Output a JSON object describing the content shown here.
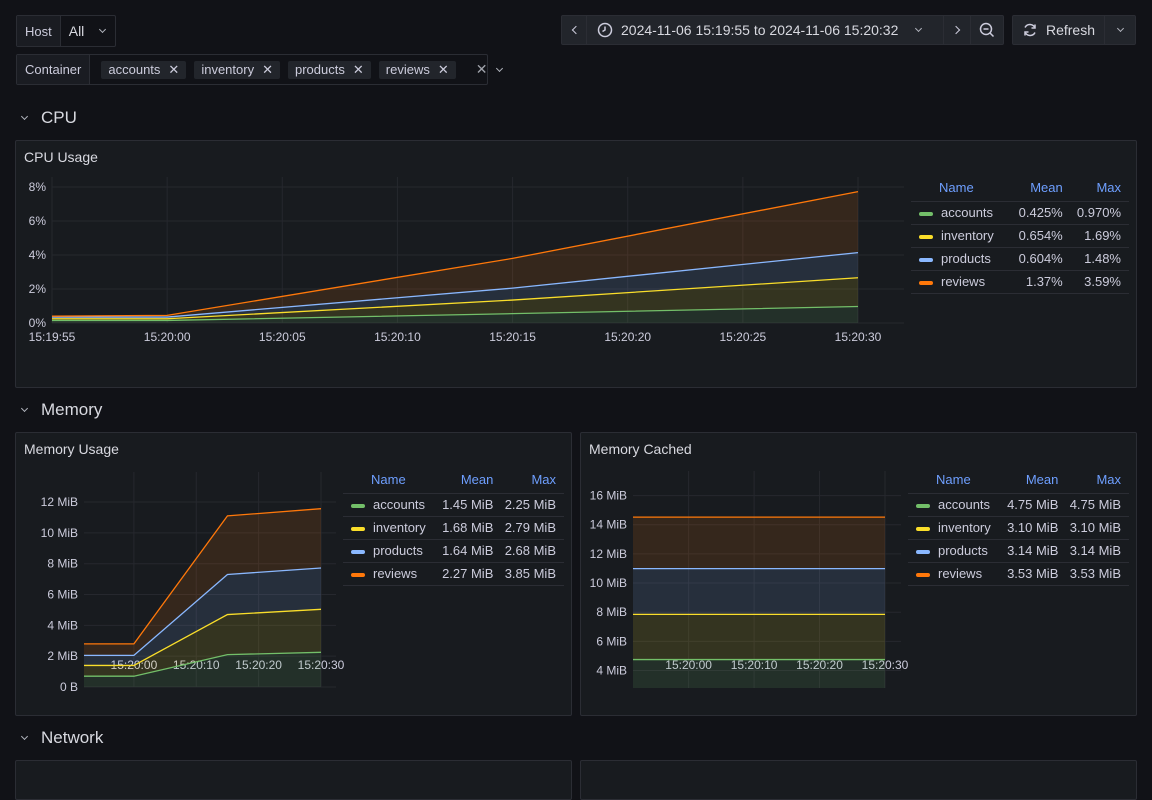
{
  "variables": {
    "host": {
      "label": "Host",
      "value": "All"
    },
    "container": {
      "label": "Container",
      "values": [
        "accounts",
        "inventory",
        "products",
        "reviews"
      ]
    }
  },
  "toolbar": {
    "time_range": "2024-11-06 15:19:55 to 2024-11-06 15:20:32",
    "refresh_label": "Refresh"
  },
  "sections": {
    "cpu": "CPU",
    "memory": "Memory",
    "network": "Network"
  },
  "series_colors": {
    "accounts": "#73bf69",
    "inventory": "#fade2a",
    "products": "#8ab8ff",
    "reviews": "#ff780a"
  },
  "legend_headers": {
    "name": "Name",
    "mean": "Mean",
    "max": "Max"
  },
  "panels": {
    "cpu_usage": {
      "title": "CPU Usage",
      "legend": [
        {
          "name": "accounts",
          "mean": "0.425%",
          "max": "0.970%"
        },
        {
          "name": "inventory",
          "mean": "0.654%",
          "max": "1.69%"
        },
        {
          "name": "products",
          "mean": "0.604%",
          "max": "1.48%"
        },
        {
          "name": "reviews",
          "mean": "1.37%",
          "max": "3.59%"
        }
      ]
    },
    "memory_usage": {
      "title": "Memory Usage",
      "legend": [
        {
          "name": "accounts",
          "mean": "1.45 MiB",
          "max": "2.25 MiB"
        },
        {
          "name": "inventory",
          "mean": "1.68 MiB",
          "max": "2.79 MiB"
        },
        {
          "name": "products",
          "mean": "1.64 MiB",
          "max": "2.68 MiB"
        },
        {
          "name": "reviews",
          "mean": "2.27 MiB",
          "max": "3.85 MiB"
        }
      ]
    },
    "memory_cached": {
      "title": "Memory Cached",
      "legend": [
        {
          "name": "accounts",
          "mean": "4.75 MiB",
          "max": "4.75 MiB"
        },
        {
          "name": "inventory",
          "mean": "3.10 MiB",
          "max": "3.10 MiB"
        },
        {
          "name": "products",
          "mean": "3.14 MiB",
          "max": "3.14 MiB"
        },
        {
          "name": "reviews",
          "mean": "3.53 MiB",
          "max": "3.53 MiB"
        }
      ]
    }
  },
  "chart_data": [
    {
      "type": "area",
      "title": "CPU Usage",
      "stacked": true,
      "x": [
        "15:19:55",
        "15:20:00",
        "15:20:15",
        "15:20:30"
      ],
      "x_seconds": [
        0,
        5,
        20,
        35
      ],
      "x_ticks": [
        "15:19:55",
        "15:20:00",
        "15:20:05",
        "15:20:10",
        "15:20:15",
        "15:20:20",
        "15:20:25",
        "15:20:30"
      ],
      "ylim": [
        0,
        8
      ],
      "y_ticks": [
        "0%",
        "2%",
        "4%",
        "6%",
        "8%"
      ],
      "y_tick_values": [
        0,
        2,
        4,
        6,
        8
      ],
      "series": [
        {
          "name": "accounts",
          "values": [
            0.15,
            0.15,
            0.55,
            0.97
          ]
        },
        {
          "name": "inventory",
          "values": [
            0.1,
            0.1,
            0.8,
            1.69
          ]
        },
        {
          "name": "products",
          "values": [
            0.1,
            0.1,
            0.7,
            1.48
          ]
        },
        {
          "name": "reviews",
          "values": [
            0.05,
            0.1,
            1.75,
            3.59
          ]
        }
      ],
      "legend": "right"
    },
    {
      "type": "area",
      "title": "Memory Usage",
      "stacked": true,
      "x": [
        "15:19:55",
        "15:20:00",
        "15:20:15",
        "15:20:30"
      ],
      "x_seconds": [
        0,
        5,
        20,
        35
      ],
      "x_ticks": [
        "15:20:00",
        "15:20:10",
        "15:20:20",
        "15:20:30"
      ],
      "x_tick_seconds": [
        5,
        15,
        25,
        35
      ],
      "ylim": [
        0,
        13.3
      ],
      "y_ticks": [
        "0 B",
        "2 MiB",
        "4 MiB",
        "6 MiB",
        "8 MiB",
        "10 MiB",
        "12 MiB"
      ],
      "y_tick_values": [
        0,
        2,
        4,
        6,
        8,
        10,
        12
      ],
      "series": [
        {
          "name": "accounts",
          "values": [
            0.7,
            0.7,
            2.1,
            2.25
          ]
        },
        {
          "name": "inventory",
          "values": [
            0.7,
            0.7,
            2.6,
            2.79
          ]
        },
        {
          "name": "products",
          "values": [
            0.65,
            0.65,
            2.6,
            2.68
          ]
        },
        {
          "name": "reviews",
          "values": [
            0.75,
            0.75,
            3.8,
            3.85
          ]
        }
      ],
      "legend": "right"
    },
    {
      "type": "area",
      "title": "Memory Cached",
      "stacked": true,
      "x": [
        "15:19:55",
        "15:20:30"
      ],
      "x_seconds": [
        0,
        35
      ],
      "x_ticks": [
        "15:20:00",
        "15:20:10",
        "15:20:20",
        "15:20:30"
      ],
      "x_tick_seconds": [
        5,
        15,
        25,
        35
      ],
      "ylim": [
        2.8,
        17
      ],
      "y_ticks": [
        "4 MiB",
        "6 MiB",
        "8 MiB",
        "10 MiB",
        "12 MiB",
        "14 MiB",
        "16 MiB"
      ],
      "y_tick_values": [
        4,
        6,
        8,
        10,
        12,
        14,
        16
      ],
      "series": [
        {
          "name": "accounts",
          "values": [
            4.75,
            4.75
          ]
        },
        {
          "name": "inventory",
          "values": [
            3.1,
            3.1
          ]
        },
        {
          "name": "products",
          "values": [
            3.14,
            3.14
          ]
        },
        {
          "name": "reviews",
          "values": [
            3.53,
            3.53
          ]
        }
      ],
      "legend": "right"
    }
  ]
}
